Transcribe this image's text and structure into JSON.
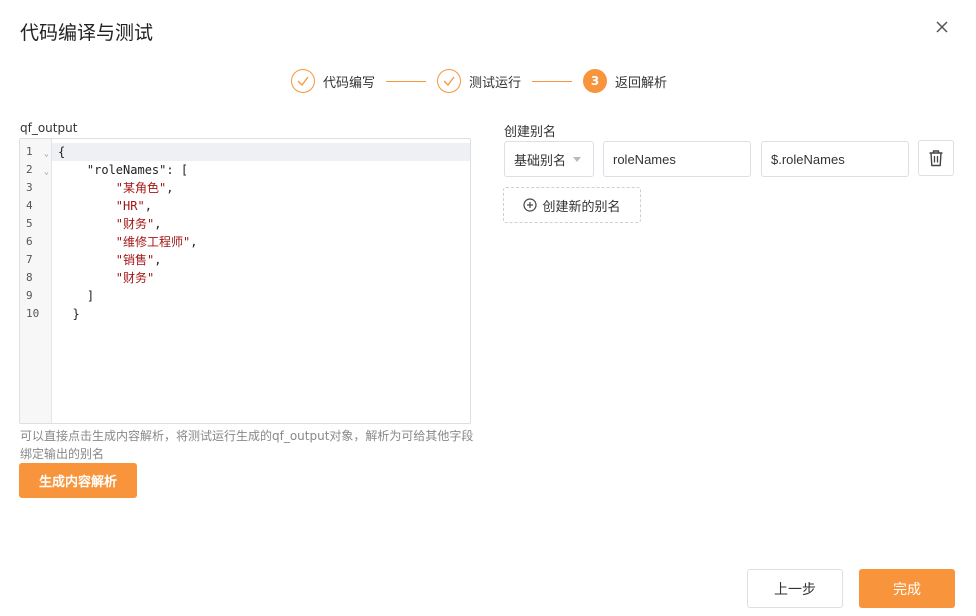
{
  "dialog": {
    "title": "代码编译与测试",
    "close_icon": "close-icon"
  },
  "steps": [
    {
      "label": "代码编写",
      "status": "done",
      "icon": "check-icon"
    },
    {
      "label": "测试运行",
      "status": "done",
      "icon": "check-icon"
    },
    {
      "label": "返回解析",
      "status": "active",
      "number": "3"
    }
  ],
  "editor": {
    "label": "qf_output",
    "lines": [
      {
        "num": "1",
        "fold": true,
        "parts": [
          {
            "t": "{",
            "s": false
          }
        ]
      },
      {
        "num": "2",
        "fold": true,
        "parts": [
          {
            "t": "    \"roleNames\": [",
            "s": false
          }
        ]
      },
      {
        "num": "3",
        "fold": false,
        "parts": [
          {
            "t": "        ",
            "s": false
          },
          {
            "t": "\"某角色\"",
            "s": true
          },
          {
            "t": ",",
            "s": false
          }
        ]
      },
      {
        "num": "4",
        "fold": false,
        "parts": [
          {
            "t": "        ",
            "s": false
          },
          {
            "t": "\"HR\"",
            "s": true
          },
          {
            "t": ",",
            "s": false
          }
        ]
      },
      {
        "num": "5",
        "fold": false,
        "parts": [
          {
            "t": "        ",
            "s": false
          },
          {
            "t": "\"财务\"",
            "s": true
          },
          {
            "t": ",",
            "s": false
          }
        ]
      },
      {
        "num": "6",
        "fold": false,
        "parts": [
          {
            "t": "        ",
            "s": false
          },
          {
            "t": "\"维修工程师\"",
            "s": true
          },
          {
            "t": ",",
            "s": false
          }
        ]
      },
      {
        "num": "7",
        "fold": false,
        "parts": [
          {
            "t": "        ",
            "s": false
          },
          {
            "t": "\"销售\"",
            "s": true
          },
          {
            "t": ",",
            "s": false
          }
        ]
      },
      {
        "num": "8",
        "fold": false,
        "parts": [
          {
            "t": "        ",
            "s": false
          },
          {
            "t": "\"财务\"",
            "s": true
          }
        ]
      },
      {
        "num": "9",
        "fold": false,
        "parts": [
          {
            "t": "    ]",
            "s": false
          }
        ]
      },
      {
        "num": "10",
        "fold": false,
        "parts": [
          {
            "t": "  }",
            "s": false
          }
        ]
      }
    ]
  },
  "hint": "可以直接点击生成内容解析，将测试运行生成的qf_output对象，解析为可给其他字段绑定输出的别名",
  "generate_button": "生成内容解析",
  "alias": {
    "label": "创建别名",
    "type_select": "基础别名",
    "name_value": "roleNames",
    "path_value": "$.roleNames",
    "delete_icon": "trash-icon",
    "add_button": "创建新的别名"
  },
  "footer": {
    "prev_button": "上一步",
    "done_button": "完成"
  },
  "colors": {
    "accent": "#f7943c",
    "string": "#a31515"
  }
}
